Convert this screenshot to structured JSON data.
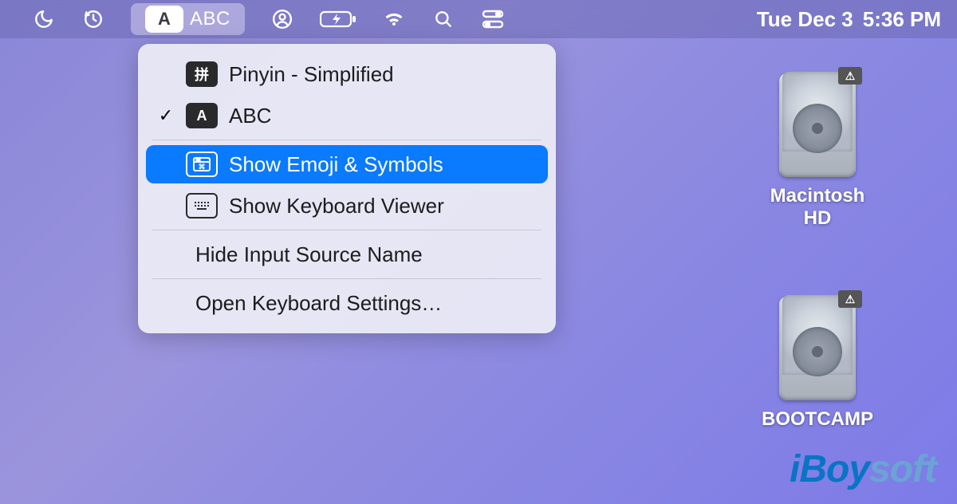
{
  "menubar": {
    "input_source": {
      "badge": "A",
      "label": "ABC"
    },
    "date": "Tue Dec 3",
    "time": "5:36 PM"
  },
  "dropdown": {
    "items": [
      {
        "icon": "pinyin-icon",
        "glyph": "拼",
        "label": "Pinyin - Simplified",
        "checked": false
      },
      {
        "icon": "abc-icon",
        "glyph": "A",
        "label": "ABC",
        "checked": true
      }
    ],
    "emoji_label": "Show Emoji & Symbols",
    "keyboard_viewer_label": "Show Keyboard Viewer",
    "hide_label": "Hide Input Source Name",
    "open_settings_label": "Open Keyboard Settings…"
  },
  "desktop": {
    "disks": [
      {
        "label": "Macintosh HD"
      },
      {
        "label": "BOOTCAMP"
      }
    ]
  },
  "watermark": {
    "prefix": "iBoy",
    "suffix": "soft"
  }
}
